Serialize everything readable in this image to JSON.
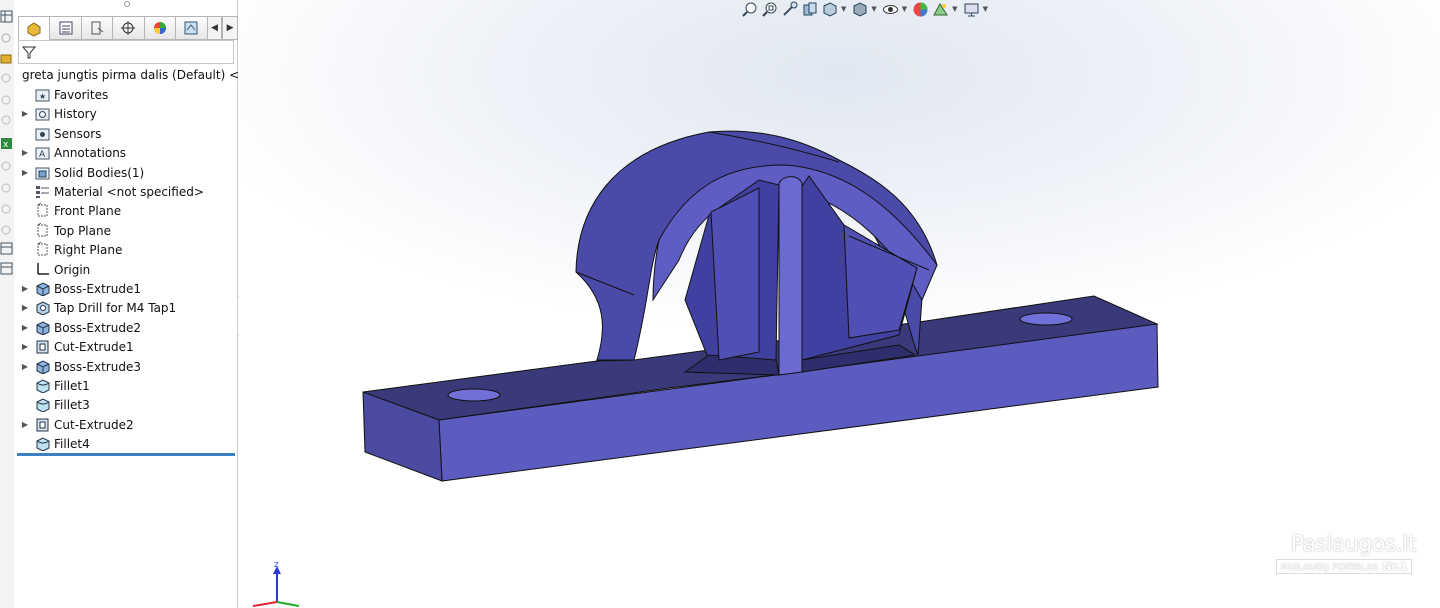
{
  "feature_tree": {
    "root_label": "greta jungtis pirma dalis  (Default) <<",
    "items": [
      {
        "label": "Favorites",
        "expandable": false,
        "icon": "favorites-folder-icon"
      },
      {
        "label": "History",
        "expandable": true,
        "icon": "history-folder-icon"
      },
      {
        "label": "Sensors",
        "expandable": false,
        "icon": "sensors-folder-icon"
      },
      {
        "label": "Annotations",
        "expandable": true,
        "icon": "annotations-folder-icon"
      },
      {
        "label": "Solid Bodies(1)",
        "expandable": true,
        "icon": "solid-bodies-folder-icon"
      },
      {
        "label": "Material <not specified>",
        "expandable": false,
        "icon": "material-icon"
      },
      {
        "label": "Front Plane",
        "expandable": false,
        "icon": "plane-icon"
      },
      {
        "label": "Top Plane",
        "expandable": false,
        "icon": "plane-icon"
      },
      {
        "label": "Right Plane",
        "expandable": false,
        "icon": "plane-icon"
      },
      {
        "label": "Origin",
        "expandable": false,
        "icon": "origin-icon"
      },
      {
        "label": "Boss-Extrude1",
        "expandable": true,
        "icon": "boss-extrude-icon"
      },
      {
        "label": "Tap Drill for M4 Tap1",
        "expandable": true,
        "icon": "hole-wizard-icon"
      },
      {
        "label": "Boss-Extrude2",
        "expandable": true,
        "icon": "boss-extrude-icon"
      },
      {
        "label": "Cut-Extrude1",
        "expandable": true,
        "icon": "cut-extrude-icon"
      },
      {
        "label": "Boss-Extrude3",
        "expandable": true,
        "icon": "boss-extrude-icon"
      },
      {
        "label": "Fillet1",
        "expandable": false,
        "icon": "fillet-icon"
      },
      {
        "label": "Fillet3",
        "expandable": false,
        "icon": "fillet-icon"
      },
      {
        "label": "Cut-Extrude2",
        "expandable": true,
        "icon": "cut-extrude-icon"
      },
      {
        "label": "Fillet4",
        "expandable": false,
        "icon": "fillet-icon"
      }
    ]
  },
  "panel_tabs": [
    "featuremanager-tab",
    "propertymanager-tab",
    "configurationmanager-tab",
    "dimxpert-tab",
    "display-manager-tab",
    "cam-tab"
  ],
  "heads_up_toolbar": [
    "zoom-to-fit-icon",
    "zoom-to-area-icon",
    "previous-view-icon",
    "section-view-icon",
    "view-orientation-icon",
    "display-style-icon",
    "hide-show-items-icon",
    "edit-appearance-icon",
    "apply-scene-icon",
    "view-settings-icon"
  ],
  "triad_label": "Z",
  "watermark": {
    "brand": "Paslaugos.lt",
    "subtitle": "PASLAUGŲ PORTALAS",
    "badge": "Nr.1"
  },
  "colors": {
    "model_front": "#5c5cc0",
    "model_top": "#3a3a7a",
    "model_side": "#4a4aa0",
    "selection_bar": "#3d7fc0"
  }
}
